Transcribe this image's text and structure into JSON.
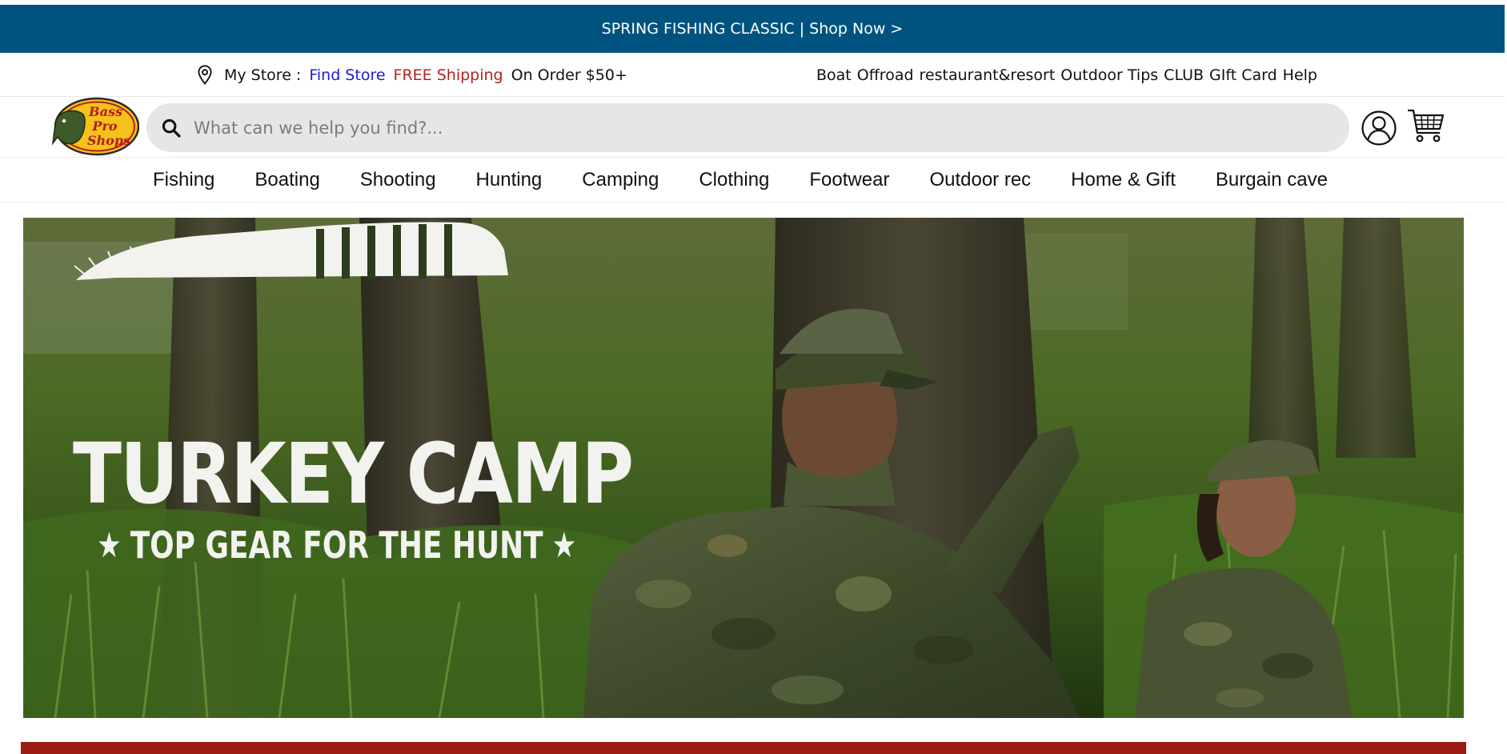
{
  "colors": {
    "promo_bg": "#00537f",
    "free_shipping": "#b22222",
    "find_store": "#1a1adc",
    "bottom_band": "#9a1c14"
  },
  "promo": {
    "text": "SPRING FISHING CLASSIC | Shop Now >"
  },
  "utility": {
    "store_label": "My Store :",
    "find_store": "Find Store",
    "free_shipping": "FREE Shipping",
    "order_min": "On Order $50+",
    "links": [
      "Boat",
      "Offroad",
      "restaurant&resort",
      "Outdoor Tips",
      "CLUB",
      "GIft Card",
      "Help"
    ]
  },
  "header": {
    "logo_text": "Bass Pro Shops",
    "search_placeholder": "What can we help you find?...",
    "icons": {
      "location": "location-pin-icon",
      "search": "search-icon",
      "account": "user-account-icon",
      "cart": "shopping-cart-icon"
    }
  },
  "nav": {
    "items": [
      "Fishing",
      "Boating",
      "Shooting",
      "Hunting",
      "Camping",
      "Clothing",
      "Footwear",
      "Outdoor rec",
      "Home & Gift",
      "Burgain cave"
    ]
  },
  "hero": {
    "title": "TURKEY CAMP",
    "subtitle": "TOP GEAR FOR THE HUNT"
  }
}
